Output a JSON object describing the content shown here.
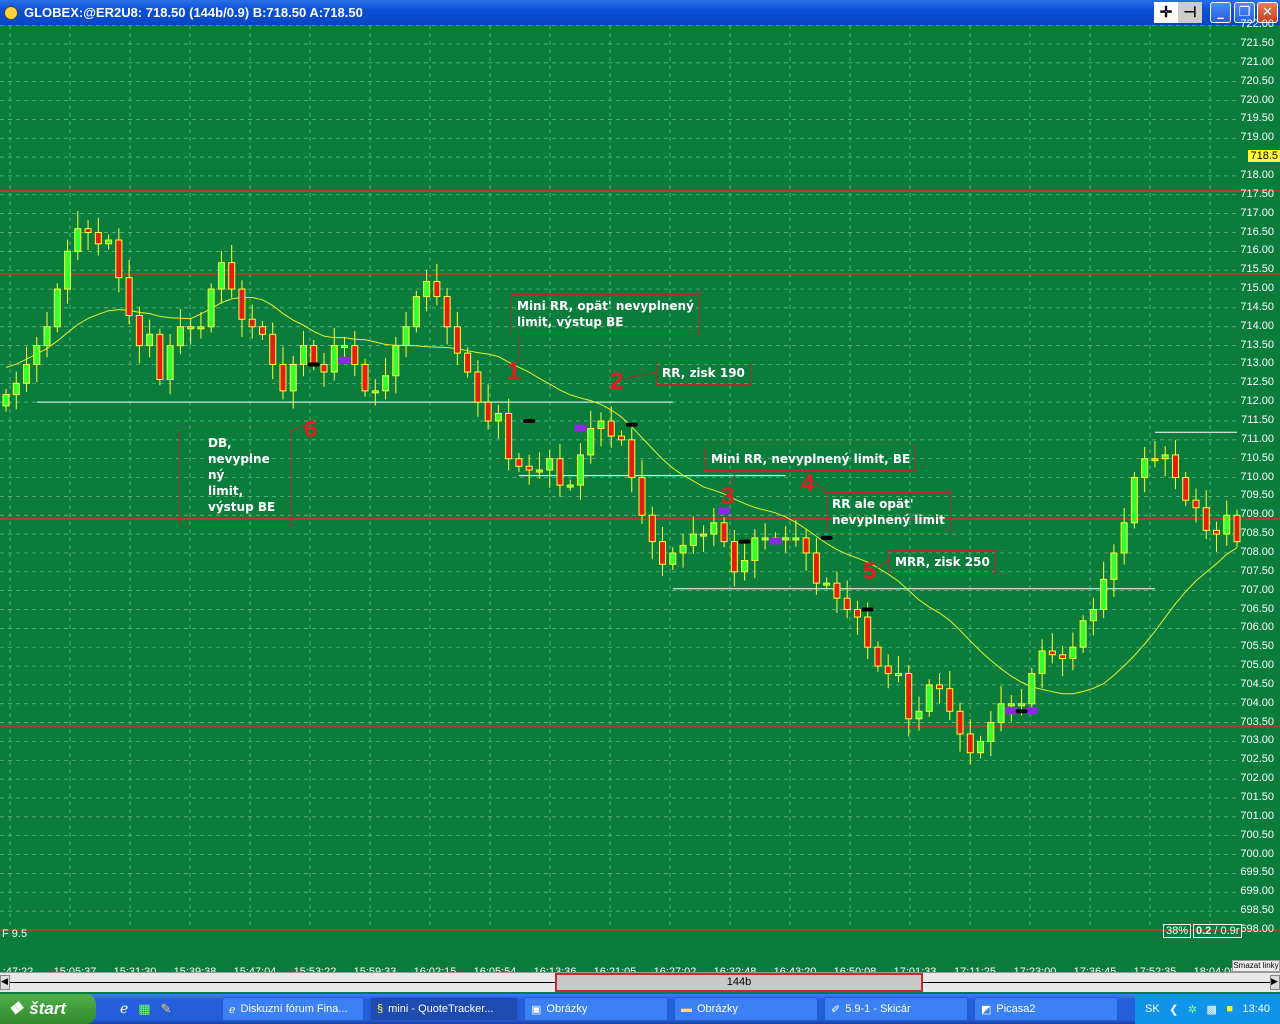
{
  "window": {
    "title": "GLOBEX:@ER2U8: 718.50 (144b/0.9)  B:718.50  A:718.50",
    "crosshair_icon": "crosshair-icon",
    "pin_icon": "pin-icon"
  },
  "colors": {
    "background": "#0a7d3c",
    "up": "#33ff33",
    "down": "#e02010",
    "wick": "#ffff33",
    "ma": "#e8f030",
    "hline_red": "#a8402a",
    "hline_white": "#ffffff",
    "marker_purple": "#8a2be2",
    "marker_black": "#000000",
    "current_price_bg": "#ffff33"
  },
  "chart_data": {
    "type": "candlestick",
    "symbol": "@ER2U8",
    "ylim": [
      698.0,
      722.0
    ],
    "grid": true,
    "y_ticks": [
      "722.00",
      "721.50",
      "721.00",
      "720.50",
      "720.00",
      "719.50",
      "719.00",
      "718.5",
      "718.00",
      "717.50",
      "717.00",
      "716.50",
      "716.00",
      "715.50",
      "715.00",
      "714.50",
      "714.00",
      "713.50",
      "713.00",
      "712.50",
      "712.00",
      "711.50",
      "711.00",
      "710.50",
      "710.00",
      "709.50",
      "709.00",
      "708.50",
      "708.00",
      "707.50",
      "707.00",
      "706.50",
      "706.00",
      "705.50",
      "705.00",
      "704.50",
      "704.00",
      "703.50",
      "703.00",
      "702.50",
      "702.00",
      "701.50",
      "701.00",
      "700.50",
      "700.00",
      "699.50",
      "699.00",
      "698.50",
      "698.00"
    ],
    "current_price": "718.5",
    "x_ticks": [
      ":47:22",
      "15:05:37",
      "15:31:30",
      "15:39:38",
      "15:47:04",
      "15:53:22",
      "15:59:33",
      "16:02:15",
      "16:05:54",
      "16:13:36",
      "16:21:05",
      "16:27:02",
      "16:32:48",
      "16:43:20",
      "16:50:08",
      "17:01:33",
      "17:11:25",
      "17:23:00",
      "17:36:45",
      "17:52:35",
      "18:04:08"
    ],
    "closes": [
      712.2,
      712.5,
      713,
      713.5,
      714,
      715,
      716,
      716.6,
      716.5,
      716.2,
      716.3,
      715.3,
      714.3,
      713.5,
      713.8,
      712.6,
      713.5,
      714,
      714,
      714,
      715,
      715.7,
      715,
      714.2,
      714,
      713.8,
      713,
      712.3,
      713,
      713.5,
      713,
      712.8,
      713.5,
      713.5,
      713,
      712.3,
      712.3,
      712.7,
      713.5,
      714,
      714.8,
      715.2,
      714.8,
      714,
      713.3,
      712.8,
      712,
      711.5,
      711.7,
      710.5,
      710.3,
      710.2,
      710.2,
      710.5,
      709.8,
      709.8,
      710.6,
      711.3,
      711.5,
      711.1,
      711,
      710,
      709,
      708.3,
      707.7,
      708,
      708.2,
      708.5,
      708.5,
      708.8,
      708.3,
      707.5,
      707.8,
      708.4,
      708.4,
      708.4,
      708.4,
      708.4,
      708,
      707.2,
      707.2,
      706.8,
      706.5,
      706.3,
      705.5,
      705,
      704.8,
      704.8,
      703.6,
      703.8,
      704.5,
      704.4,
      703.8,
      703.2,
      702.7,
      703,
      703.5,
      704,
      704,
      704,
      704.8,
      705.4,
      705.3,
      705.2,
      705.5,
      706.2,
      706.5,
      707.3,
      708,
      708.8,
      710,
      710.5,
      710.5,
      710.6,
      710,
      709.4,
      709.2,
      708.6,
      708.5,
      709,
      708.3
    ],
    "red_levels": [
      717.6,
      715.4,
      708.9,
      703.4,
      698.0
    ],
    "white_levels": [
      {
        "price": 712.0,
        "from_bar": 3,
        "to_bar": 65
      },
      {
        "price": 710.05,
        "from_bar": 50,
        "to_bar": 76
      },
      {
        "price": 707.05,
        "from_bar": 65,
        "to_bar": 112
      },
      {
        "price": 711.2,
        "from_bar": 112,
        "to_bar": 120
      }
    ],
    "purple_markers": [
      {
        "bar": 33,
        "price": 713.1
      },
      {
        "bar": 56,
        "price": 711.3
      },
      {
        "bar": 70,
        "price": 709.1
      },
      {
        "bar": 75,
        "price": 708.3
      },
      {
        "bar": 98,
        "price": 703.8
      },
      {
        "bar": 100,
        "price": 703.8
      }
    ],
    "black_markers": [
      {
        "bar": 30,
        "price": 713.0
      },
      {
        "bar": 51,
        "price": 711.5
      },
      {
        "bar": 61,
        "price": 711.4
      },
      {
        "bar": 72,
        "price": 708.3
      },
      {
        "bar": 80,
        "price": 708.4
      },
      {
        "bar": 84,
        "price": 706.5
      },
      {
        "bar": 99,
        "price": 703.8
      }
    ]
  },
  "annotations": [
    {
      "num": "1",
      "text": "Mini RR, opät' nevyplnený\nlimit, výstup BE"
    },
    {
      "num": "2",
      "text": "RR, zisk 190"
    },
    {
      "num": "3",
      "text": "Mini RR, nevyplnený limit, BE"
    },
    {
      "num": "4",
      "text": "RR ale opät'\nnevyplnený limit"
    },
    {
      "num": "5",
      "text": "MRR, zisk 250"
    },
    {
      "num": "6",
      "text": "DB,\nnevyplne\nný\nlimit,\nvýstup BE"
    }
  ],
  "status": {
    "f_value": "F 9.5",
    "zoom_pct": "38%",
    "ratio_bold": "0.2",
    "ratio_rest": " / 0.9r",
    "clear_lines": "Smazat linky"
  },
  "scrollbar": {
    "label": "144b"
  },
  "taskbar": {
    "start": "štart",
    "tasks": [
      "Diskuzní fórum Fina...",
      "mini - QuoteTracker...",
      "Obrázky",
      "Obrázky",
      "5.9-1 - Skicár",
      "Picasa2"
    ],
    "lang": "SK",
    "clock": "13:40"
  }
}
